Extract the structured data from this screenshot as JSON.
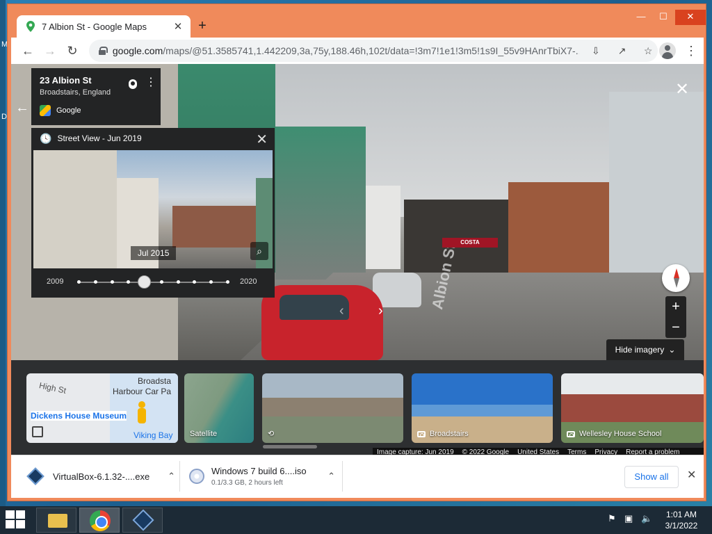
{
  "browser": {
    "tab_title": "7 Albion St - Google Maps",
    "new_tab": "+",
    "url_host": "google.com",
    "url_path": "/maps/@51.3585741,1.442209,3a,75y,188.46h,102t/data=!3m7!1e1!3m5!1s9I_55v9HAnrTbiX7-...",
    "window_controls": {
      "minimize": "—",
      "maximize": "☐",
      "close": "✕"
    }
  },
  "streetview": {
    "place_title": "23 Albion St",
    "place_subtitle": "Broadstairs, England",
    "provider": "Google",
    "road_label": "Albion St",
    "shop_sign": "COSTA",
    "close_icon": "✕",
    "hide_imagery_label": "Hide imagery",
    "zoom_in": "+",
    "zoom_out": "−"
  },
  "timeline": {
    "header": "Street View - Jun 2019",
    "preview_date": "Jul 2015",
    "year_start": "2009",
    "year_end": "2020",
    "points": 10,
    "selected_index": 4
  },
  "cards": [
    {
      "label": "",
      "type": "map"
    },
    {
      "label": "Satellite",
      "type": "satellite"
    },
    {
      "label": "",
      "type": "streetview"
    },
    {
      "label": "Broadstairs",
      "type": "photo"
    },
    {
      "label": "Wellesley House School",
      "type": "photo"
    }
  ],
  "map_card": {
    "label_poi": "Dickens House Museum",
    "label_street": "High St",
    "label_town": "Broadsta",
    "label_park": "Harbour Car Pa",
    "label_bay": "Viking Bay"
  },
  "footer": {
    "capture": "Image capture: Jun 2019",
    "copyright": "© 2022 Google",
    "region": "United States",
    "terms": "Terms",
    "privacy": "Privacy",
    "report": "Report a problem"
  },
  "downloads": {
    "item1_name": "VirtualBox-6.1.32-....exe",
    "item2_name": "Windows 7 build 6....iso",
    "item2_status": "0.1/3.3 GB, 2 hours left",
    "show_all": "Show all",
    "close": "✕"
  },
  "taskbar": {
    "time": "1:01 AM",
    "date": "3/1/2022"
  },
  "desktop": {
    "letter_m": "M",
    "letter_d": "D"
  }
}
